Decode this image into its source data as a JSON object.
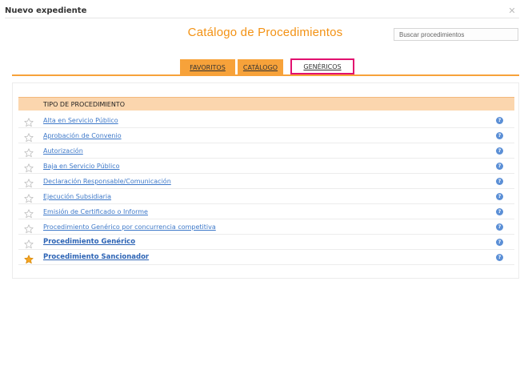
{
  "dialog": {
    "title": "Nuevo expediente",
    "close_glyph": "✕"
  },
  "catalog": {
    "title": "Catálogo de Procedimientos"
  },
  "search": {
    "placeholder": "Buscar procedimientos",
    "value": ""
  },
  "tabs": [
    {
      "label": "FAVORITOS",
      "active": false
    },
    {
      "label": "CATÁLOGO",
      "active": false
    },
    {
      "label": "GENÉRICOS",
      "active": true
    }
  ],
  "table": {
    "header": "TIPO DE PROCEDIMIENTO",
    "rows": [
      {
        "label": "Alta en Servicio Público",
        "favorite": false,
        "bold": false
      },
      {
        "label": "Aprobación de Convenio",
        "favorite": false,
        "bold": false
      },
      {
        "label": "Autorización",
        "favorite": false,
        "bold": false
      },
      {
        "label": "Baja en Servicio Público",
        "favorite": false,
        "bold": false
      },
      {
        "label": "Declaración Responsable/Comunicación",
        "favorite": false,
        "bold": false
      },
      {
        "label": "Ejecución Subsidiaria",
        "favorite": false,
        "bold": false
      },
      {
        "label": "Emisión de Certificado o Informe",
        "favorite": false,
        "bold": false
      },
      {
        "label": "Procedimiento Genérico por concurrencia competitiva",
        "favorite": false,
        "bold": false
      },
      {
        "label": "Procedimiento Genérico",
        "favorite": false,
        "bold": true
      },
      {
        "label": "Procedimiento Sancionador",
        "favorite": true,
        "bold": true
      }
    ],
    "help_glyph": "?"
  },
  "colors": {
    "accent": "#f39214",
    "tab_bg": "#f7a23a",
    "active_tab_border": "#e2106f",
    "header_bg": "#fbd6ae",
    "link": "#3e79c9",
    "star_on": "#f5a623",
    "star_off": "#bdbdbd"
  }
}
